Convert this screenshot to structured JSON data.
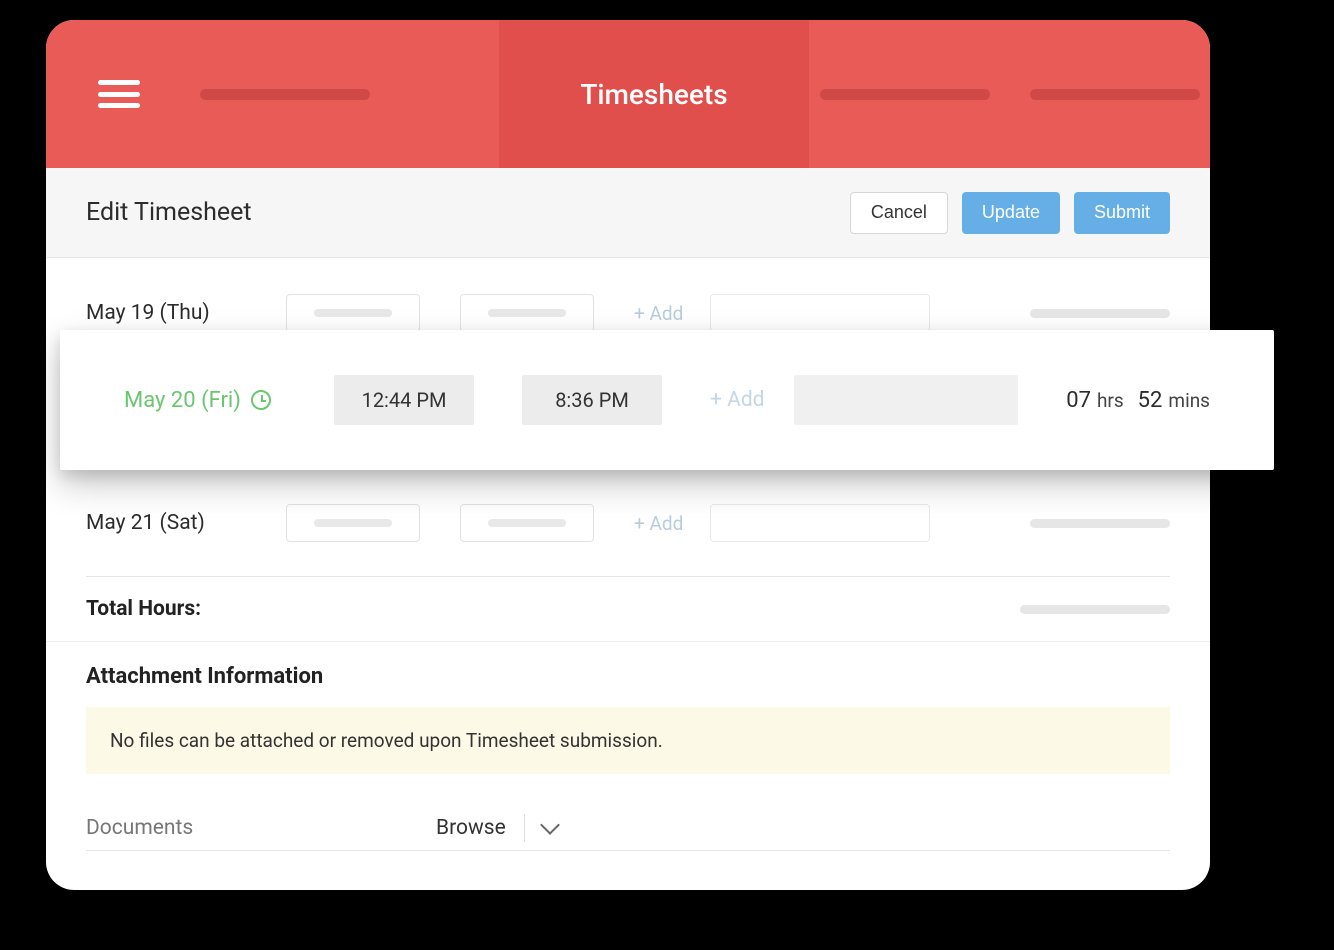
{
  "header": {
    "title": "Timesheets"
  },
  "subheader": {
    "title": "Edit Timesheet",
    "cancel": "Cancel",
    "update": "Update",
    "submit": "Submit"
  },
  "rows": {
    "r0": {
      "label": "May 19 (Thu)",
      "add": "+ Add"
    },
    "r1": {
      "label": "May 20 (Fri)",
      "start": "12:44 PM",
      "end": "8:36 PM",
      "add": "+ Add",
      "hours_num": "07",
      "hours_unit": "hrs",
      "mins_num": "52",
      "mins_unit": "mins"
    },
    "r2": {
      "label": "May 21 (Sat)",
      "add": "+ Add"
    }
  },
  "total_label": "Total Hours:",
  "attachment": {
    "title": "Attachment Information",
    "warning": "No files can be attached or removed upon Timesheet submission."
  },
  "documents": {
    "label": "Documents",
    "browse": "Browse"
  }
}
